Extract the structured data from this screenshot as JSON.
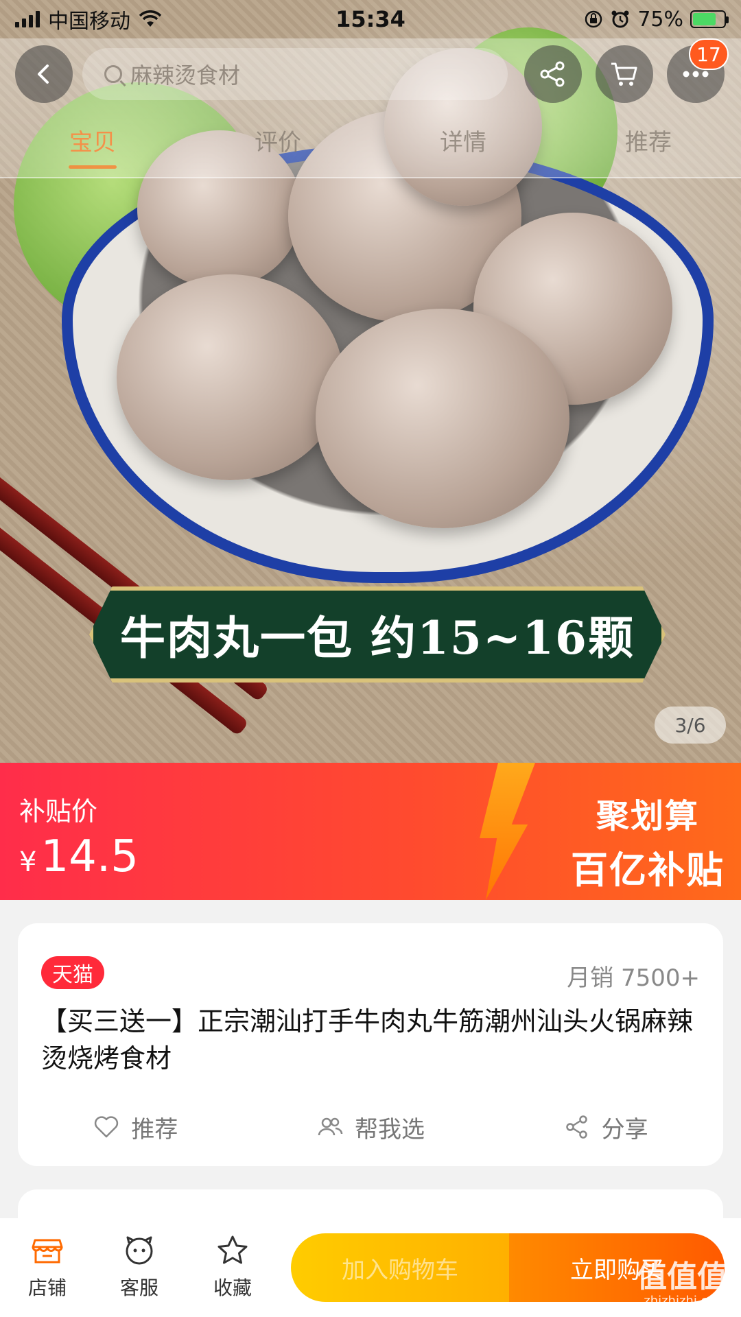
{
  "status_bar": {
    "carrier": "中国移动",
    "time": "15:34",
    "battery": "75%"
  },
  "navbar": {
    "search_placeholder": "麻辣烫食材",
    "badge_count": "17",
    "tabs": [
      {
        "label": "宝贝",
        "active": true
      },
      {
        "label": "评价",
        "active": false
      },
      {
        "label": "详情",
        "active": false
      },
      {
        "label": "推荐",
        "active": false
      }
    ]
  },
  "hero": {
    "banner_text": "牛肉丸一包 约15~16颗",
    "pager": "3/6"
  },
  "price_bar": {
    "label": "补贴价",
    "currency": "¥",
    "price": "14.5",
    "promo_line1": "聚划算",
    "promo_line2": "百亿补贴"
  },
  "product": {
    "store_tag": "天猫",
    "monthly_sales": "月销 7500+",
    "title": "【买三送一】正宗潮汕打手牛肉丸牛筋潮州汕头火锅麻辣烫烧烤食材",
    "actions": {
      "recommend": "推荐",
      "help_choose": "帮我选",
      "share": "分享"
    }
  },
  "bottom_bar": {
    "store": "店铺",
    "service": "客服",
    "favorite": "收藏",
    "add_to_cart": "加入购物车",
    "buy_now": "立即购买"
  },
  "watermark": {
    "brand": "值值值",
    "url": "zhizhizhi.com"
  },
  "colors": {
    "price_red": "#ff2d4a",
    "accent_orange": "#ff5a00",
    "cart_yellow": "#ffcc00"
  }
}
